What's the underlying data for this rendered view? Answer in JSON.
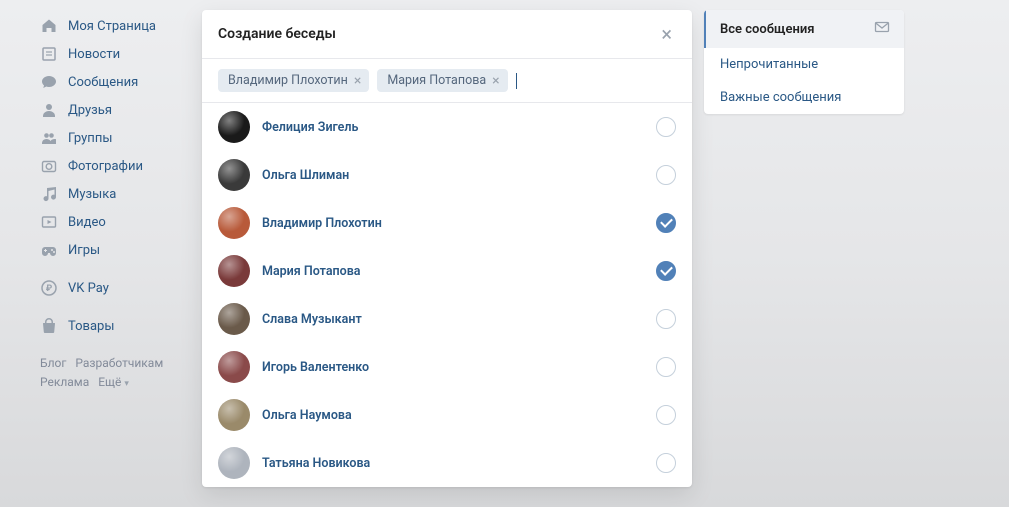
{
  "nav": {
    "items": [
      {
        "label": "Моя Страница",
        "icon": "home"
      },
      {
        "label": "Новости",
        "icon": "news"
      },
      {
        "label": "Сообщения",
        "icon": "messages"
      },
      {
        "label": "Друзья",
        "icon": "friends"
      },
      {
        "label": "Группы",
        "icon": "groups"
      },
      {
        "label": "Фотографии",
        "icon": "photos"
      },
      {
        "label": "Музыка",
        "icon": "music"
      },
      {
        "label": "Видео",
        "icon": "video"
      },
      {
        "label": "Игры",
        "icon": "games"
      }
    ],
    "vkpay": {
      "label": "VK Pay"
    },
    "market": {
      "label": "Товары"
    },
    "footer": {
      "blog": "Блог",
      "devs": "Разработчикам",
      "ads": "Реклама",
      "more": "Ещё"
    }
  },
  "modal": {
    "title": "Создание беседы",
    "chips": [
      {
        "label": "Владимир Плохотин"
      },
      {
        "label": "Мария Потапова"
      }
    ],
    "friends": [
      {
        "name": "Фелиция Зигель",
        "selected": false,
        "avatar_bg": "#1a1a1a"
      },
      {
        "name": "Ольга Шлиман",
        "selected": false,
        "avatar_bg": "#3a3a3a"
      },
      {
        "name": "Владимир Плохотин",
        "selected": true,
        "avatar_bg": "#b85a3a"
      },
      {
        "name": "Мария Потапова",
        "selected": true,
        "avatar_bg": "#7a3a3a"
      },
      {
        "name": "Слава Музыкант",
        "selected": false,
        "avatar_bg": "#6a5a4a"
      },
      {
        "name": "Игорь Валентенко",
        "selected": false,
        "avatar_bg": "#8a4a4a"
      },
      {
        "name": "Ольга Наумова",
        "selected": false,
        "avatar_bg": "#9a8a6a"
      },
      {
        "name": "Татьяна Новикова",
        "selected": false,
        "avatar_bg": "#aeb4bd"
      }
    ]
  },
  "filters": {
    "items": [
      {
        "label": "Все сообщения",
        "active": true
      },
      {
        "label": "Непрочитанные",
        "active": false
      },
      {
        "label": "Важные сообщения",
        "active": false
      }
    ]
  }
}
